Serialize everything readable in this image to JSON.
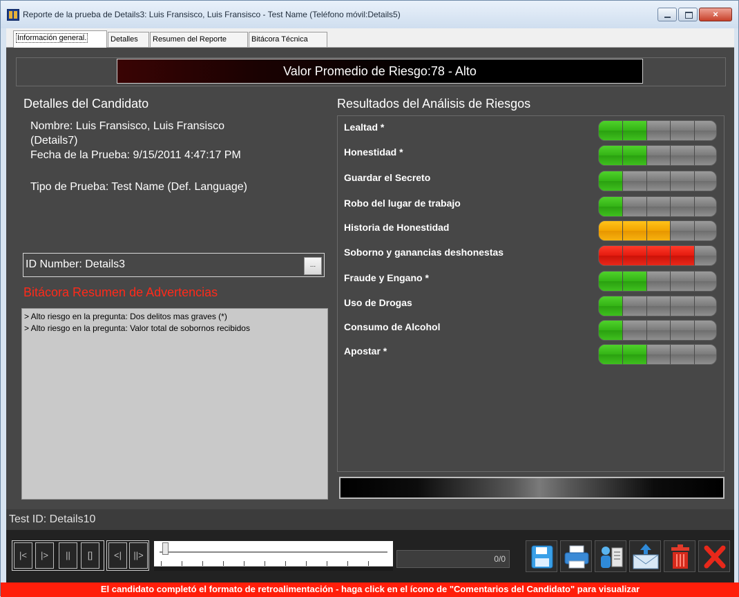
{
  "window": {
    "title": "Reporte de la prueba de Details3: Luis Fransisco, Luis Fransisco - Test Name (Teléfono móvil:Details5)",
    "close_glyph": "×"
  },
  "tabs": [
    {
      "label": "Información general.",
      "active": true
    },
    {
      "label": "Detalles"
    },
    {
      "label": "Resumen del Reporte"
    },
    {
      "label": "Bitácora Técnica"
    }
  ],
  "banner": {
    "text": "Valor Promedio de Riesgo:78 - Alto"
  },
  "candidate": {
    "title": "Detalles del Candidato",
    "name_line1": "Nombre: Luis Fransisco, Luis Fransisco",
    "name_line2": "(Details7)",
    "date": "Fecha de la Prueba: 9/15/2011 4:47:17 PM",
    "test_type": "Tipo de Prueba: Test Name (Def. Language)"
  },
  "id_number": {
    "label": "ID Number: Details3",
    "button": "..."
  },
  "warnings": {
    "title": "Bitácora Resumen de Advertencias",
    "lines": [
      "> Alto riesgo en la pregunta: Dos delitos mas graves (*)",
      "> Alto riesgo en la pregunta: Valor total de sobornos recibidos"
    ]
  },
  "risk": {
    "title": "Resultados del Análisis de Riesgos",
    "items": [
      {
        "label": "Lealtad  *",
        "level": 0.4,
        "color": "green"
      },
      {
        "label": "Honestidad  *",
        "level": 0.4,
        "color": "green"
      },
      {
        "label": "Guardar el Secreto",
        "level": 0.2,
        "color": "green"
      },
      {
        "label": "Robo del lugar de trabajo",
        "level": 0.2,
        "color": "green"
      },
      {
        "label": "Historia de Honestidad",
        "level": 0.6,
        "color": "orange"
      },
      {
        "label": "Soborno y ganancias deshonestas",
        "level": 0.8,
        "color": "red"
      },
      {
        "label": "Fraude y Engano  *",
        "level": 0.4,
        "color": "green"
      },
      {
        "label": "Uso de Drogas",
        "level": 0.2,
        "color": "green"
      },
      {
        "label": "Consumo de Alcohol",
        "level": 0.2,
        "color": "green"
      },
      {
        "label": "Apostar  *",
        "level": 0.4,
        "color": "green"
      }
    ]
  },
  "test_id": "Test ID: Details10",
  "player": {
    "counter": "0/0",
    "controls": [
      "|<",
      "|>",
      "||",
      "[]",
      "<|",
      "||>"
    ]
  },
  "toolbar": {
    "icons": [
      "save-icon",
      "print-icon",
      "candidate-comments-icon",
      "send-email-icon",
      "delete-icon",
      "close-icon"
    ]
  },
  "status_bar": "El candidato completó el formato de retroalimentación - haga click en el ícono de \"Comentarios del Candidato\" para visualizar",
  "colors": {
    "green": "#3cc01c",
    "orange": "#f5a800",
    "red": "#e01a0e",
    "status_red": "#ff1e0a"
  }
}
